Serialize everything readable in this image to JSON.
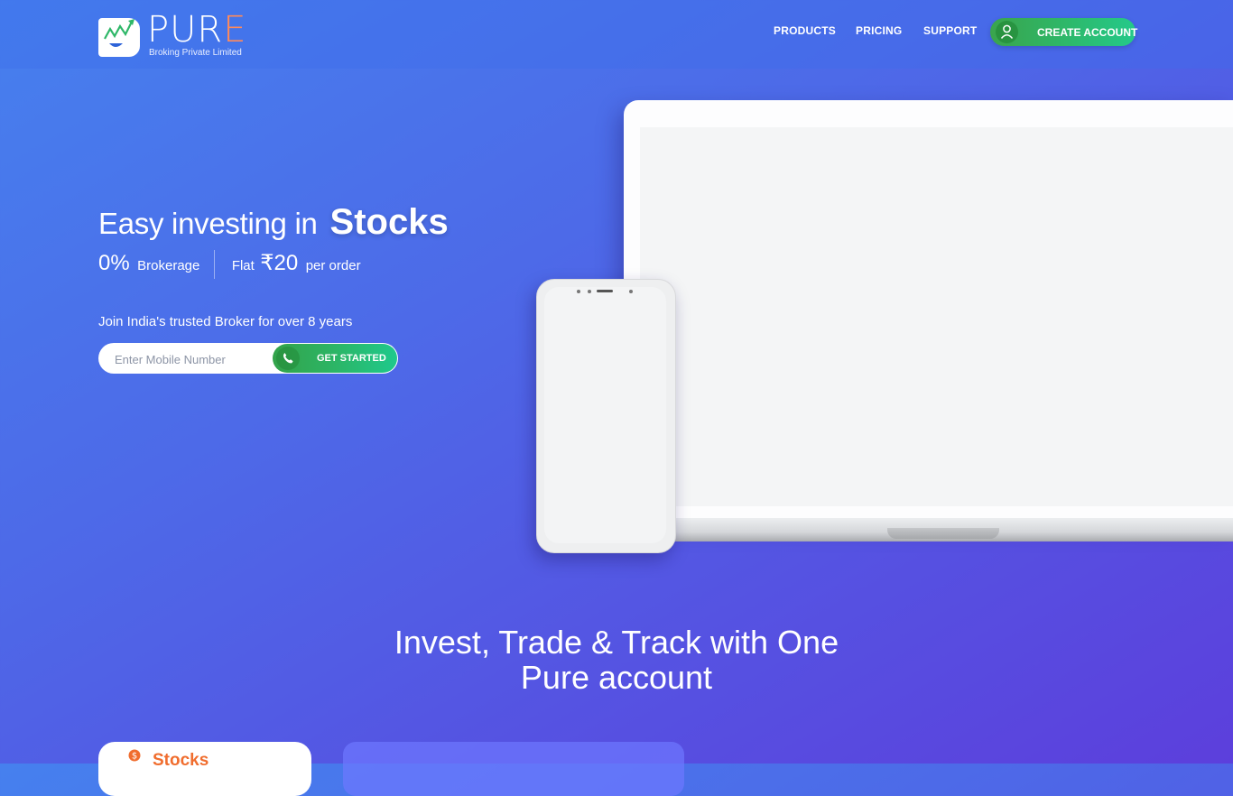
{
  "brand": {
    "name_main": "PUR",
    "name_accent": "E",
    "tagline": "Broking Private Limited"
  },
  "nav": {
    "products": "PRODUCTS",
    "pricing": "PRICING",
    "support": "SUPPORT",
    "create_account": "CREATE ACCOUNT",
    "create_account_icon": "user-icon"
  },
  "hero": {
    "title_prefix": "Easy investing in",
    "title_highlight": "Stocks",
    "brokerage_value": "0%",
    "brokerage_label": "Brokerage",
    "flat_label": "Flat",
    "flat_value": "₹20",
    "flat_suffix": "per order",
    "join_text": "Join India's trusted Broker for over 8 years",
    "mobile_placeholder": "Enter Mobile Number",
    "cta_label": "GET STARTED",
    "cta_icon": "phone-icon"
  },
  "section": {
    "title_line1": "Invest, Trade & Track with One",
    "title_line2": "Pure account"
  },
  "product_tabs": {
    "active_label": "Stocks",
    "active_icon": "stocks-coin-icon"
  },
  "colors": {
    "accent_green": "#2eb768",
    "accent_orange": "#f06d2e",
    "background_start": "#4680ee",
    "background_end": "#5c3fdc"
  }
}
